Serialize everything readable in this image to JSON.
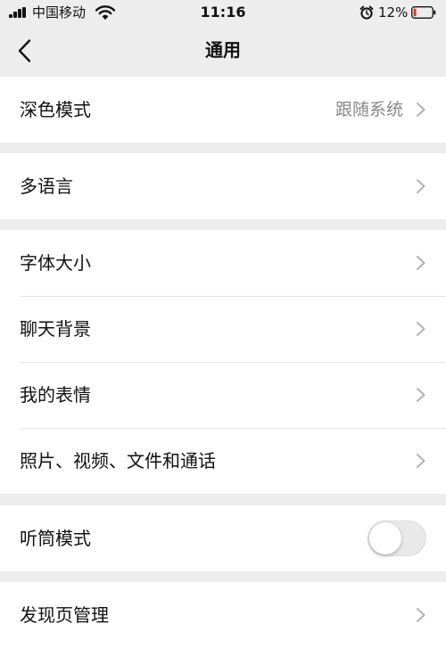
{
  "status_bar": {
    "carrier": "中国移动",
    "time": "11:16",
    "battery": "12%"
  },
  "nav": {
    "title": "通用"
  },
  "groups": {
    "display": {
      "dark_mode": {
        "label": "深色模式",
        "value": "跟随系统"
      }
    },
    "language": {
      "multi_language": {
        "label": "多语言"
      }
    },
    "chat": {
      "font_size": {
        "label": "字体大小"
      },
      "chat_background": {
        "label": "聊天背景"
      },
      "my_stickers": {
        "label": "我的表情"
      },
      "media_files_calls": {
        "label": "照片、视频、文件和通话"
      }
    },
    "earpiece": {
      "earpiece_mode": {
        "label": "听筒模式",
        "enabled": false
      }
    },
    "discover": {
      "discover_management": {
        "label": "发现页管理"
      }
    }
  },
  "colors": {
    "background": "#ededed",
    "cell": "#ffffff",
    "secondary_text": "#888888",
    "chevron": "#b2b2b2",
    "battery_low": "#e0362d"
  }
}
